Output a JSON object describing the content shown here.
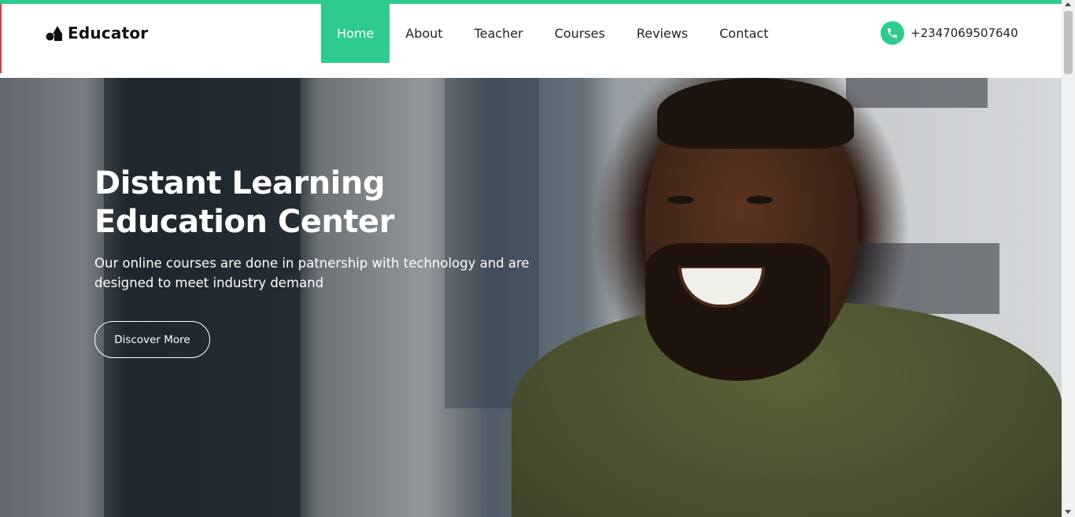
{
  "brand": {
    "name": "Educator",
    "icon": "shapes-logo-icon"
  },
  "nav": {
    "items": [
      {
        "label": "Home",
        "active": true
      },
      {
        "label": "About",
        "active": false
      },
      {
        "label": "Teacher",
        "active": false
      },
      {
        "label": "Courses",
        "active": false
      },
      {
        "label": "Reviews",
        "active": false
      },
      {
        "label": "Contact",
        "active": false
      }
    ]
  },
  "contact": {
    "phone": "+2347069507640",
    "icon": "phone-icon"
  },
  "hero": {
    "title_line1": "Distant Learning",
    "title_line2": "Education Center",
    "subtitle_line1": "Our online courses are done in patnership with technology and are",
    "subtitle_line2": "designed to meet industry demand",
    "button_label": "Discover More"
  },
  "colors": {
    "accent": "#2ecb8f",
    "text_dark": "#222222",
    "hero_text": "#ffffff"
  }
}
